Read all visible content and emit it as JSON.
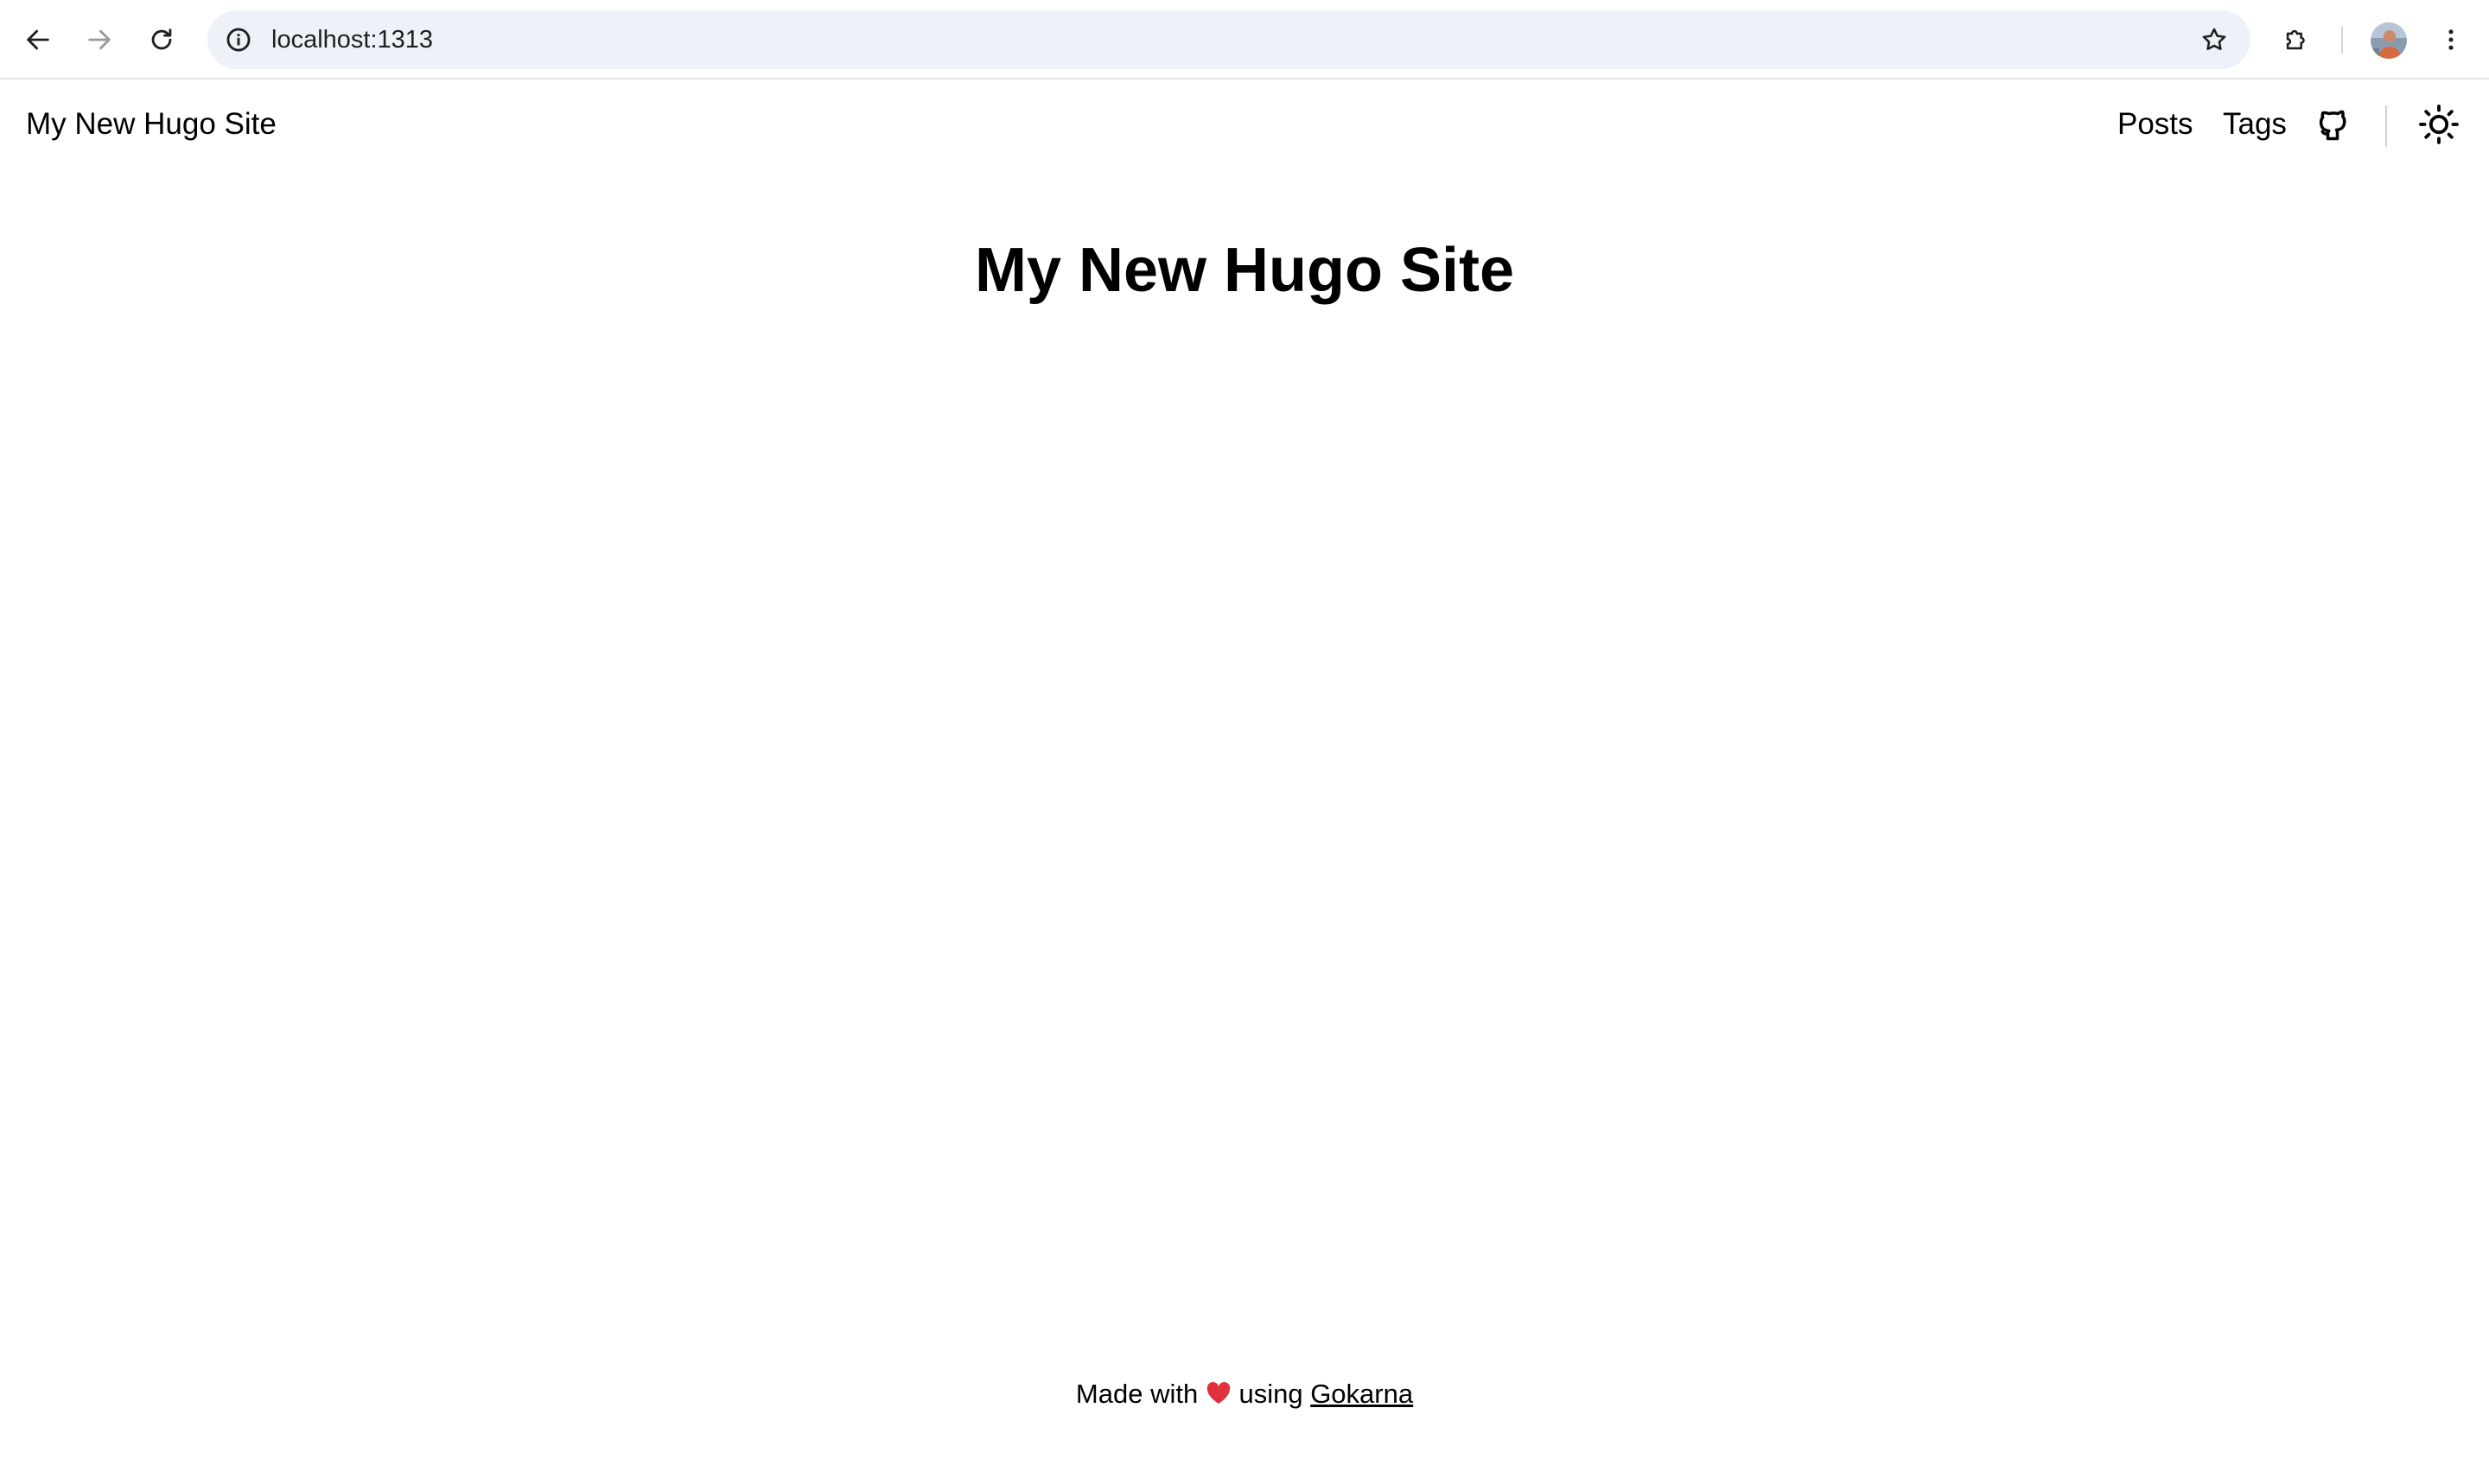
{
  "browser": {
    "url": "localhost:1313",
    "icons": {
      "back": "arrow-left-icon",
      "forward": "arrow-right-icon",
      "reload": "reload-icon",
      "site_info": "info-icon",
      "bookmark": "star-icon",
      "extensions": "puzzle-icon",
      "menu": "more-vertical-icon",
      "profile": "avatar"
    }
  },
  "site": {
    "brand": "My New Hugo Site",
    "menu": {
      "posts": "Posts",
      "tags": "Tags",
      "github_icon": "github-icon",
      "theme_icon": "sun-icon"
    },
    "title": "My New Hugo Site",
    "footer": {
      "made_with": "Made with",
      "heart": "❤️",
      "using": "using",
      "link": "Gokarna"
    }
  },
  "colors": {
    "text": "#000000",
    "omnibox_bg": "#edf1f8",
    "heart": "#e0323c"
  }
}
